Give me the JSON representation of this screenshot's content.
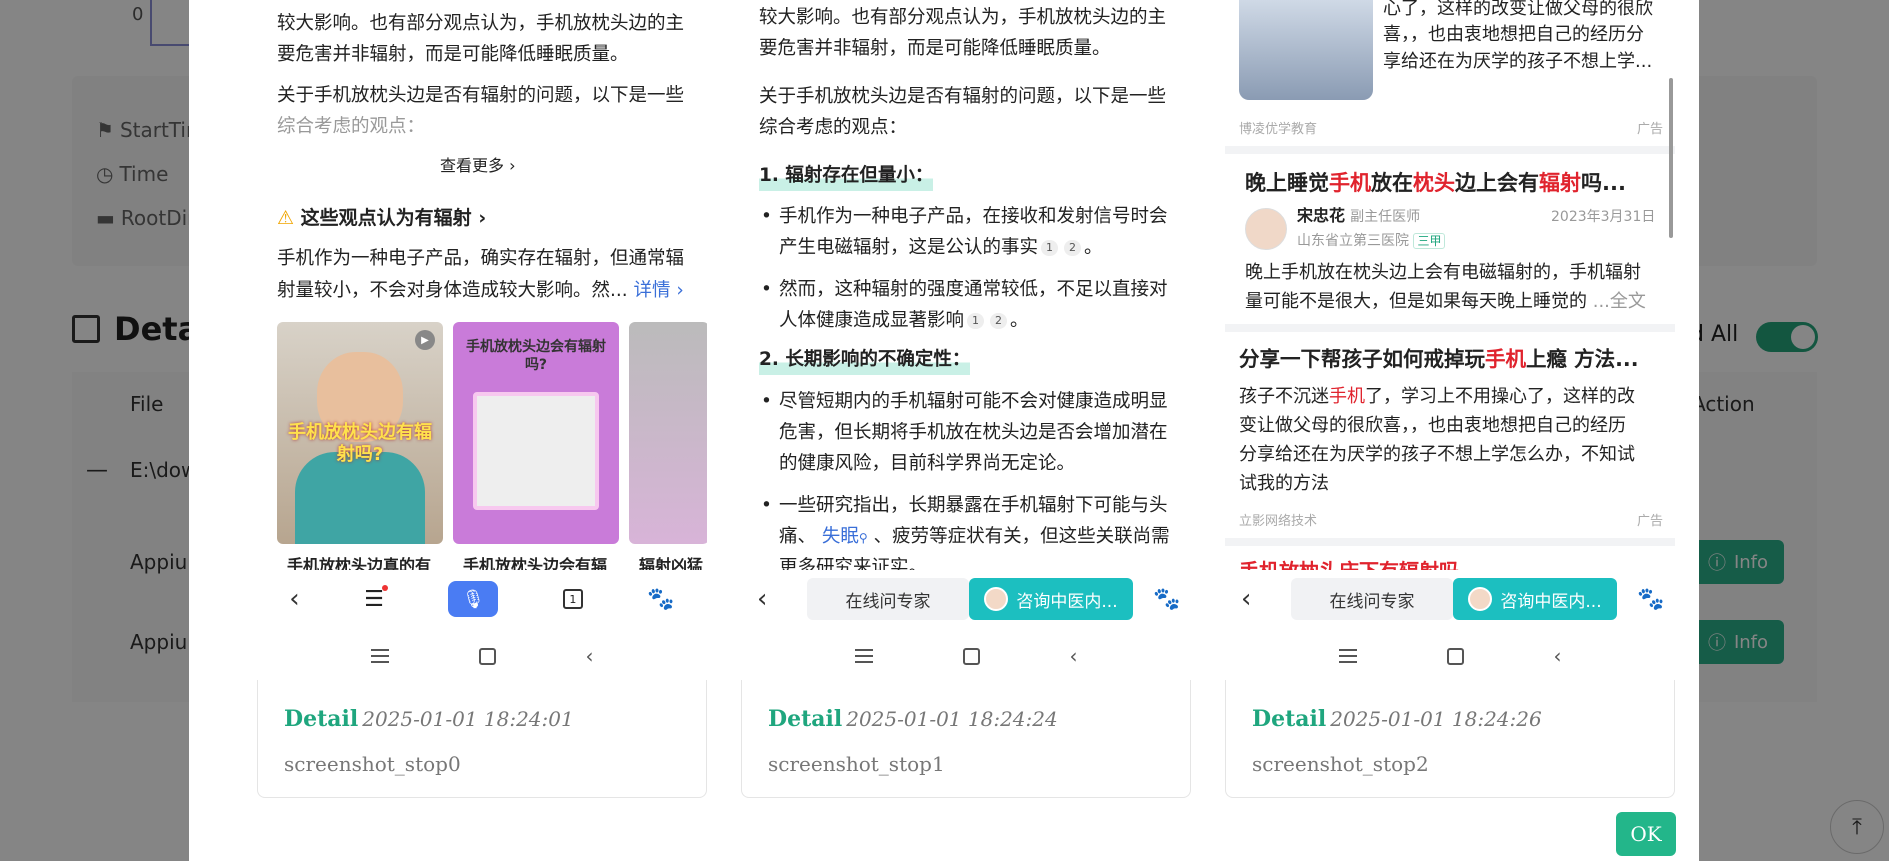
{
  "background": {
    "chart_zero": "0",
    "meta": [
      "StartTim",
      "Time",
      "RootDir"
    ],
    "detail_title": "Detai",
    "read_all": "d All",
    "col_file": "File",
    "col_action": "Action",
    "row_path": "E:\\dow",
    "rows": [
      "Appium",
      "Appium"
    ],
    "info_label": "Info",
    "to_top": "⤒"
  },
  "modal": {
    "ok_label": "OK",
    "screens": [
      {
        "caption_label": "Detail",
        "caption_time": "2025-01-01 18:24:01",
        "caption_file": "screenshot_stop0",
        "p1": "较大影响。也有部分观点认为，手机放枕头边的主",
        "p2": "要危害并非辐射，而是可能降低睡眠质量。",
        "p3": "关于手机放枕头边是否有辐射的问题，以下是一些",
        "p4": "综合考虑的观点：",
        "see_more": "查看更多 ›",
        "section_title": "这些观点认为有辐射",
        "section_body1": "手机作为一种电子产品，确实存在辐射，但通常辐",
        "section_body2": "射量较小，不会对身体造成较大影响。然...",
        "details_link": "详情 ›",
        "thumb1_overlay": "手机放枕头边有辐射吗?",
        "thumb2_overlay": "手机放枕头边会有辐射吗?",
        "thumb1_label": "手机放枕头边真的有",
        "thumb2_label": "手机放枕头边会有辐",
        "thumb3_label": "辐射凶猛"
      },
      {
        "caption_label": "Detail",
        "caption_time": "2025-01-01 18:24:24",
        "caption_file": "screenshot_stop1",
        "p1": "较大影响。也有部分观点认为，手机放枕头边的主",
        "p2": "要危害并非辐射，而是可能降低睡眠质量。",
        "p3": "关于手机放枕头边是否有辐射的问题，以下是一些",
        "p4": "综合考虑的观点：",
        "h1": "1. 辐射存在但量小：",
        "b1a": "手机作为一种电子产品，在接收和发射信号时会",
        "b1b": "产生电磁辐射，这是公认的事实",
        "b2a": "然而，这种辐射的强度通常较低，不足以直接对",
        "b2b": "人体健康造成显著影响",
        "h2": "2. 长期影响的不确定性：",
        "b3a": "尽管短期内的手机辐射可能不会对健康造成明显",
        "b3b": "危害，但长期将手机放在枕头边是否会增加潜在",
        "b3c": "的健康风险，目前科学界尚无定论。",
        "b4a": "一些研究指出，长期暴露在手机辐射下可能与头",
        "b4b_pre": "痛、",
        "b4b_link": "失眠",
        "b4b_post": "、疲劳等症状有关，但这些关联尚需",
        "b4c": "更多研究来证实。",
        "chip_expert": "在线问专家",
        "chip_consult": "咨询中医内..."
      },
      {
        "caption_label": "Detail",
        "caption_time": "2025-01-01 18:24:26",
        "caption_file": "screenshot_stop2",
        "top1": "心了，这样的改变让做父母的很欣",
        "top2": "喜，，也由衷地想把自己的经历分",
        "top3": "享给还在为厌学的孩子不想上学...",
        "ad1_source": "博凌优学教育",
        "ad_label": "广告",
        "card_title_a": "晚上睡觉",
        "card_title_b": "手机",
        "card_title_c": "放在",
        "card_title_d": "枕头",
        "card_title_e": "边上会有",
        "card_title_f": "辐射",
        "card_title_g": "吗...",
        "doctor_name": "宋忠花",
        "doctor_title": "副主任医师",
        "doctor_date": "2023年3月31日",
        "hospital": "山东省立第三医院",
        "hospital_tag": "三甲",
        "card_body1": "晚上手机放在枕头边上会有电磁辐射的，手机辐射",
        "card_body2": "量可能不是很大，但是如果每天晚上睡觉的",
        "full_text": "...全文",
        "ad2_title_a": "分享一下帮孩子如何戒掉玩",
        "ad2_title_b": "手机",
        "ad2_title_c": "上瘾 方法...",
        "ad2_body1_a": "孩子不沉迷",
        "ad2_body1_b": "手机",
        "ad2_body1_c": "了，学习上不用操心了，这样的改",
        "ad2_body2": "变让做父母的很欣喜，，也由衷地想把自己的经历",
        "ad2_body3": "分享给还在为厌学的孩子不想上学怎么办，不知试",
        "ad2_body4": "试我的方法",
        "ad2_source": "立影网络技术",
        "next_title": "手机放枕头床下有辐射吗",
        "chip_expert": "在线问专家",
        "chip_consult": "咨询中医内..."
      }
    ]
  },
  "colors": {
    "accent": "#1fa67e",
    "teal_chip": "#1cbfc0",
    "red_keyword": "#e0232d",
    "link_blue": "#3a6fd8",
    "mic_blue": "#4a7cf3"
  }
}
